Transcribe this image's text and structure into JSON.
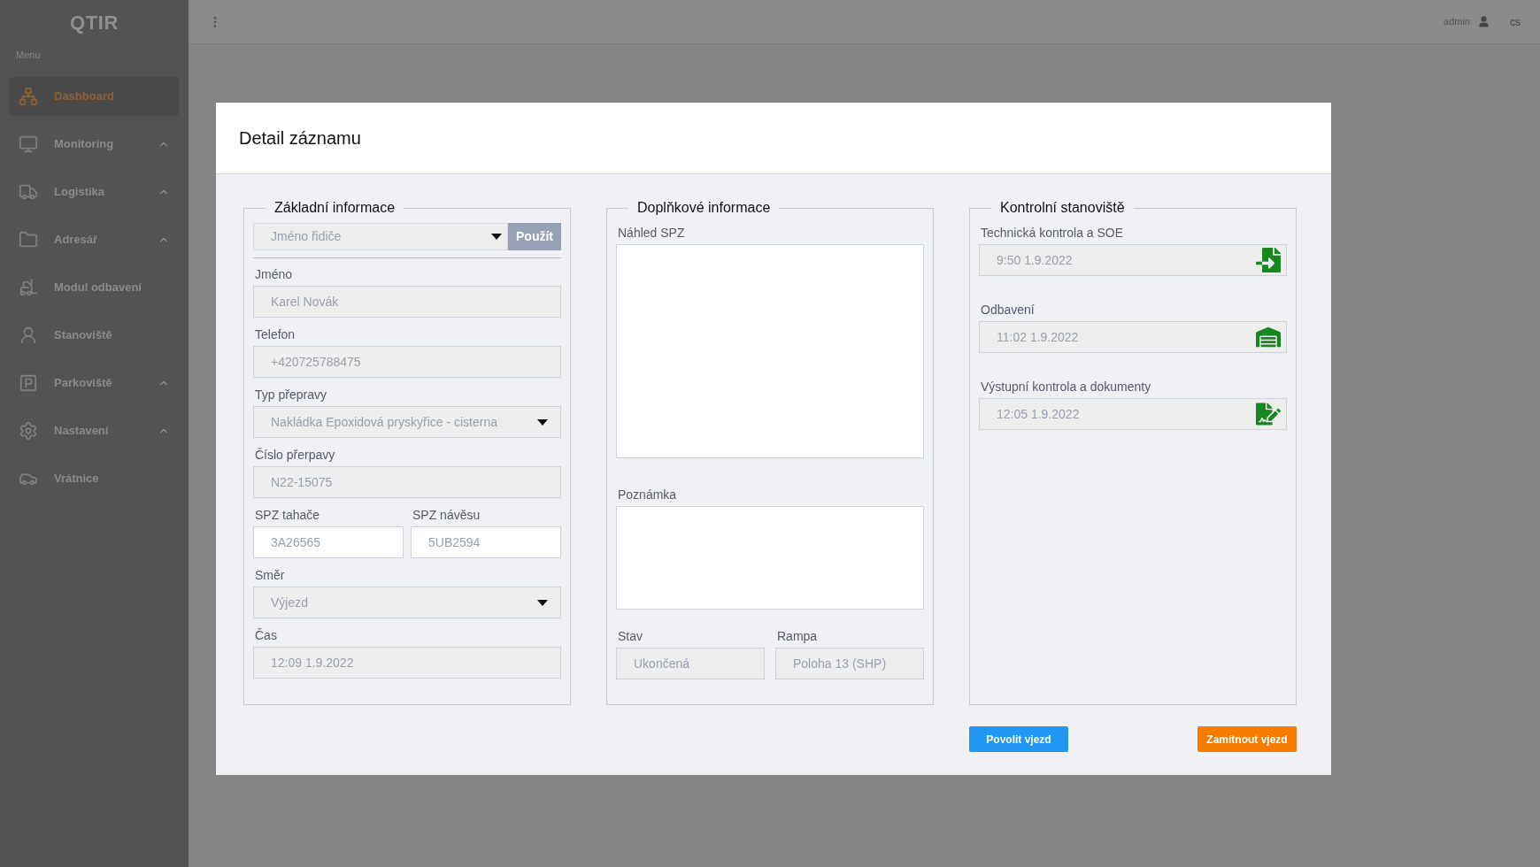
{
  "sidebar": {
    "logo": "QTIR",
    "menu_label": "Menu",
    "items": [
      {
        "label": "Dashboard",
        "selected": true,
        "has_submenu": false
      },
      {
        "label": "Monitoring",
        "selected": false,
        "has_submenu": true
      },
      {
        "label": "Logistika",
        "selected": false,
        "has_submenu": true
      },
      {
        "label": "Adresář",
        "selected": false,
        "has_submenu": true
      },
      {
        "label": "Modul odbavení",
        "selected": false,
        "has_submenu": false
      },
      {
        "label": "Stanoviště",
        "selected": false,
        "has_submenu": false
      },
      {
        "label": "Parkoviště",
        "selected": false,
        "has_submenu": true
      },
      {
        "label": "Nastavení",
        "selected": false,
        "has_submenu": true
      },
      {
        "label": "Vrátnice",
        "selected": false,
        "has_submenu": false
      }
    ]
  },
  "topbar": {
    "user": "admin",
    "language": "cs"
  },
  "dialog": {
    "title": "Detail záznamu",
    "sections": [
      {
        "kind": "basic",
        "title": "Základní informace",
        "driver_select": {
          "placeholder": "Jméno řidiče"
        },
        "apply_button": "Použít",
        "fields": [
          {
            "kind": "input",
            "label": "Jméno",
            "value": "Karel Novák",
            "disabled": true
          },
          {
            "kind": "input",
            "label": "Telefon",
            "value": "+420725788475",
            "disabled": true
          },
          {
            "kind": "select",
            "label": "Typ přepravy",
            "value": "Nakládka Epoxidová pryskyřice - cisterna",
            "disabled": true
          },
          {
            "kind": "input",
            "label": "Číslo přerpavy",
            "value": "N22-15075",
            "disabled": true
          },
          {
            "kind": "pair",
            "items": [
              {
                "label": "SPZ tahače",
                "value": "3A26565",
                "disabled": false
              },
              {
                "label": "SPZ návěsu",
                "value": "5UB2594",
                "disabled": false
              }
            ]
          },
          {
            "kind": "select",
            "label": "Směr",
            "value": "Výjezd",
            "disabled": true
          },
          {
            "kind": "input",
            "label": "Čas",
            "value": "12:09 1.9.2022",
            "disabled": true
          }
        ]
      },
      {
        "kind": "extra",
        "title": "Doplňkové informace",
        "preview": {
          "label": "Náhled SPZ"
        },
        "note": {
          "label": "Poznámka"
        },
        "fields": [
          {
            "label": "Stav",
            "value": "Ukončená"
          },
          {
            "label": "Rampa",
            "value": "Poloha 13 (SHP)"
          }
        ]
      },
      {
        "kind": "checkpoints",
        "title": "Kontrolní stanoviště",
        "items": [
          {
            "label": "Technická kontrola a SOE",
            "value": "9:50 1.9.2022"
          },
          {
            "label": "Odbavení",
            "value": "11:02 1.9.2022"
          },
          {
            "label": "Výstupní kontrola a dokumenty",
            "value": "12:05 1.9.2022"
          }
        ]
      }
    ],
    "buttons": [
      {
        "label": "Povolit vjezd",
        "kind": "primary"
      },
      {
        "label": "Zamítnout vjezd",
        "kind": "danger"
      }
    ]
  }
}
